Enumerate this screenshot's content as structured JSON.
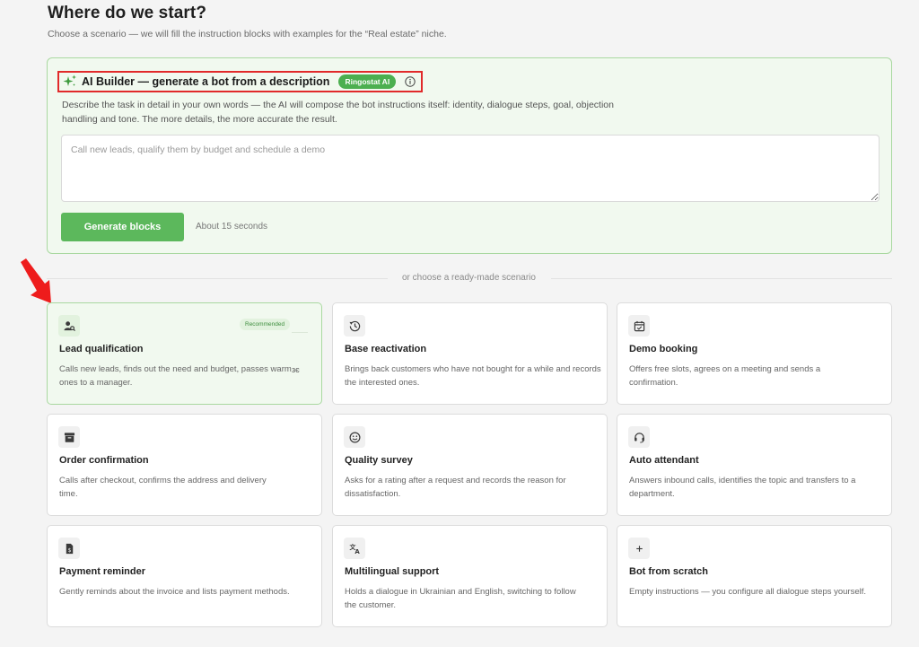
{
  "header": {
    "title": "Where do we start?",
    "subtitle": "Choose a scenario — we will fill the instruction blocks with examples for the “Real estate” niche."
  },
  "ai_builder": {
    "title": "AI Builder — generate a bot from a description",
    "badge": "Ringostat AI",
    "description": "Describe the task in detail in your own words — the AI will compose the bot instructions itself: identity, dialogue steps, goal, objection handling and tone. The more details, the more accurate the result.",
    "placeholder": "Call new leads, qualify them by budget and schedule a demo",
    "value": "",
    "button": "Generate blocks",
    "hint": "About 15 seconds",
    "accent_color": "#5cb85c",
    "highlight_color": "#e12a2a"
  },
  "divider_text": "or choose a ready-made scenario",
  "scenarios": [
    {
      "icon": "user-search-icon",
      "title": "Lead qualification",
      "desc": "Calls new leads, finds out the need and budget, passes warm ones to a manager.",
      "badge": "Recommended",
      "stray": "зє",
      "selected": true
    },
    {
      "icon": "history-icon",
      "title": "Base reactivation",
      "desc": "Brings back customers who have not bought for a while and records the interested ones."
    },
    {
      "icon": "calendar-check-icon",
      "title": "Demo booking",
      "desc": "Offers free slots, agrees on a meeting and sends a confirmation."
    },
    {
      "icon": "archive-box-icon",
      "title": "Order confirmation",
      "desc": "Calls after checkout, confirms the address and delivery time."
    },
    {
      "icon": "smile-icon",
      "title": "Quality survey",
      "desc": "Asks for a rating after a request and records the reason for dissatisfaction."
    },
    {
      "icon": "headset-icon",
      "title": "Auto attendant",
      "desc": "Answers inbound calls, identifies the topic and transfers to a department."
    },
    {
      "icon": "invoice-icon",
      "title": "Payment reminder",
      "desc": "Gently reminds about the invoice and lists payment methods."
    },
    {
      "icon": "translate-icon",
      "title": "Multilingual support",
      "desc": "Holds a dialogue in Ukrainian and English, switching to follow the customer."
    },
    {
      "icon": "plus-icon",
      "title": "Bot from scratch",
      "desc": "Empty instructions — you configure all dialogue steps yourself."
    }
  ]
}
